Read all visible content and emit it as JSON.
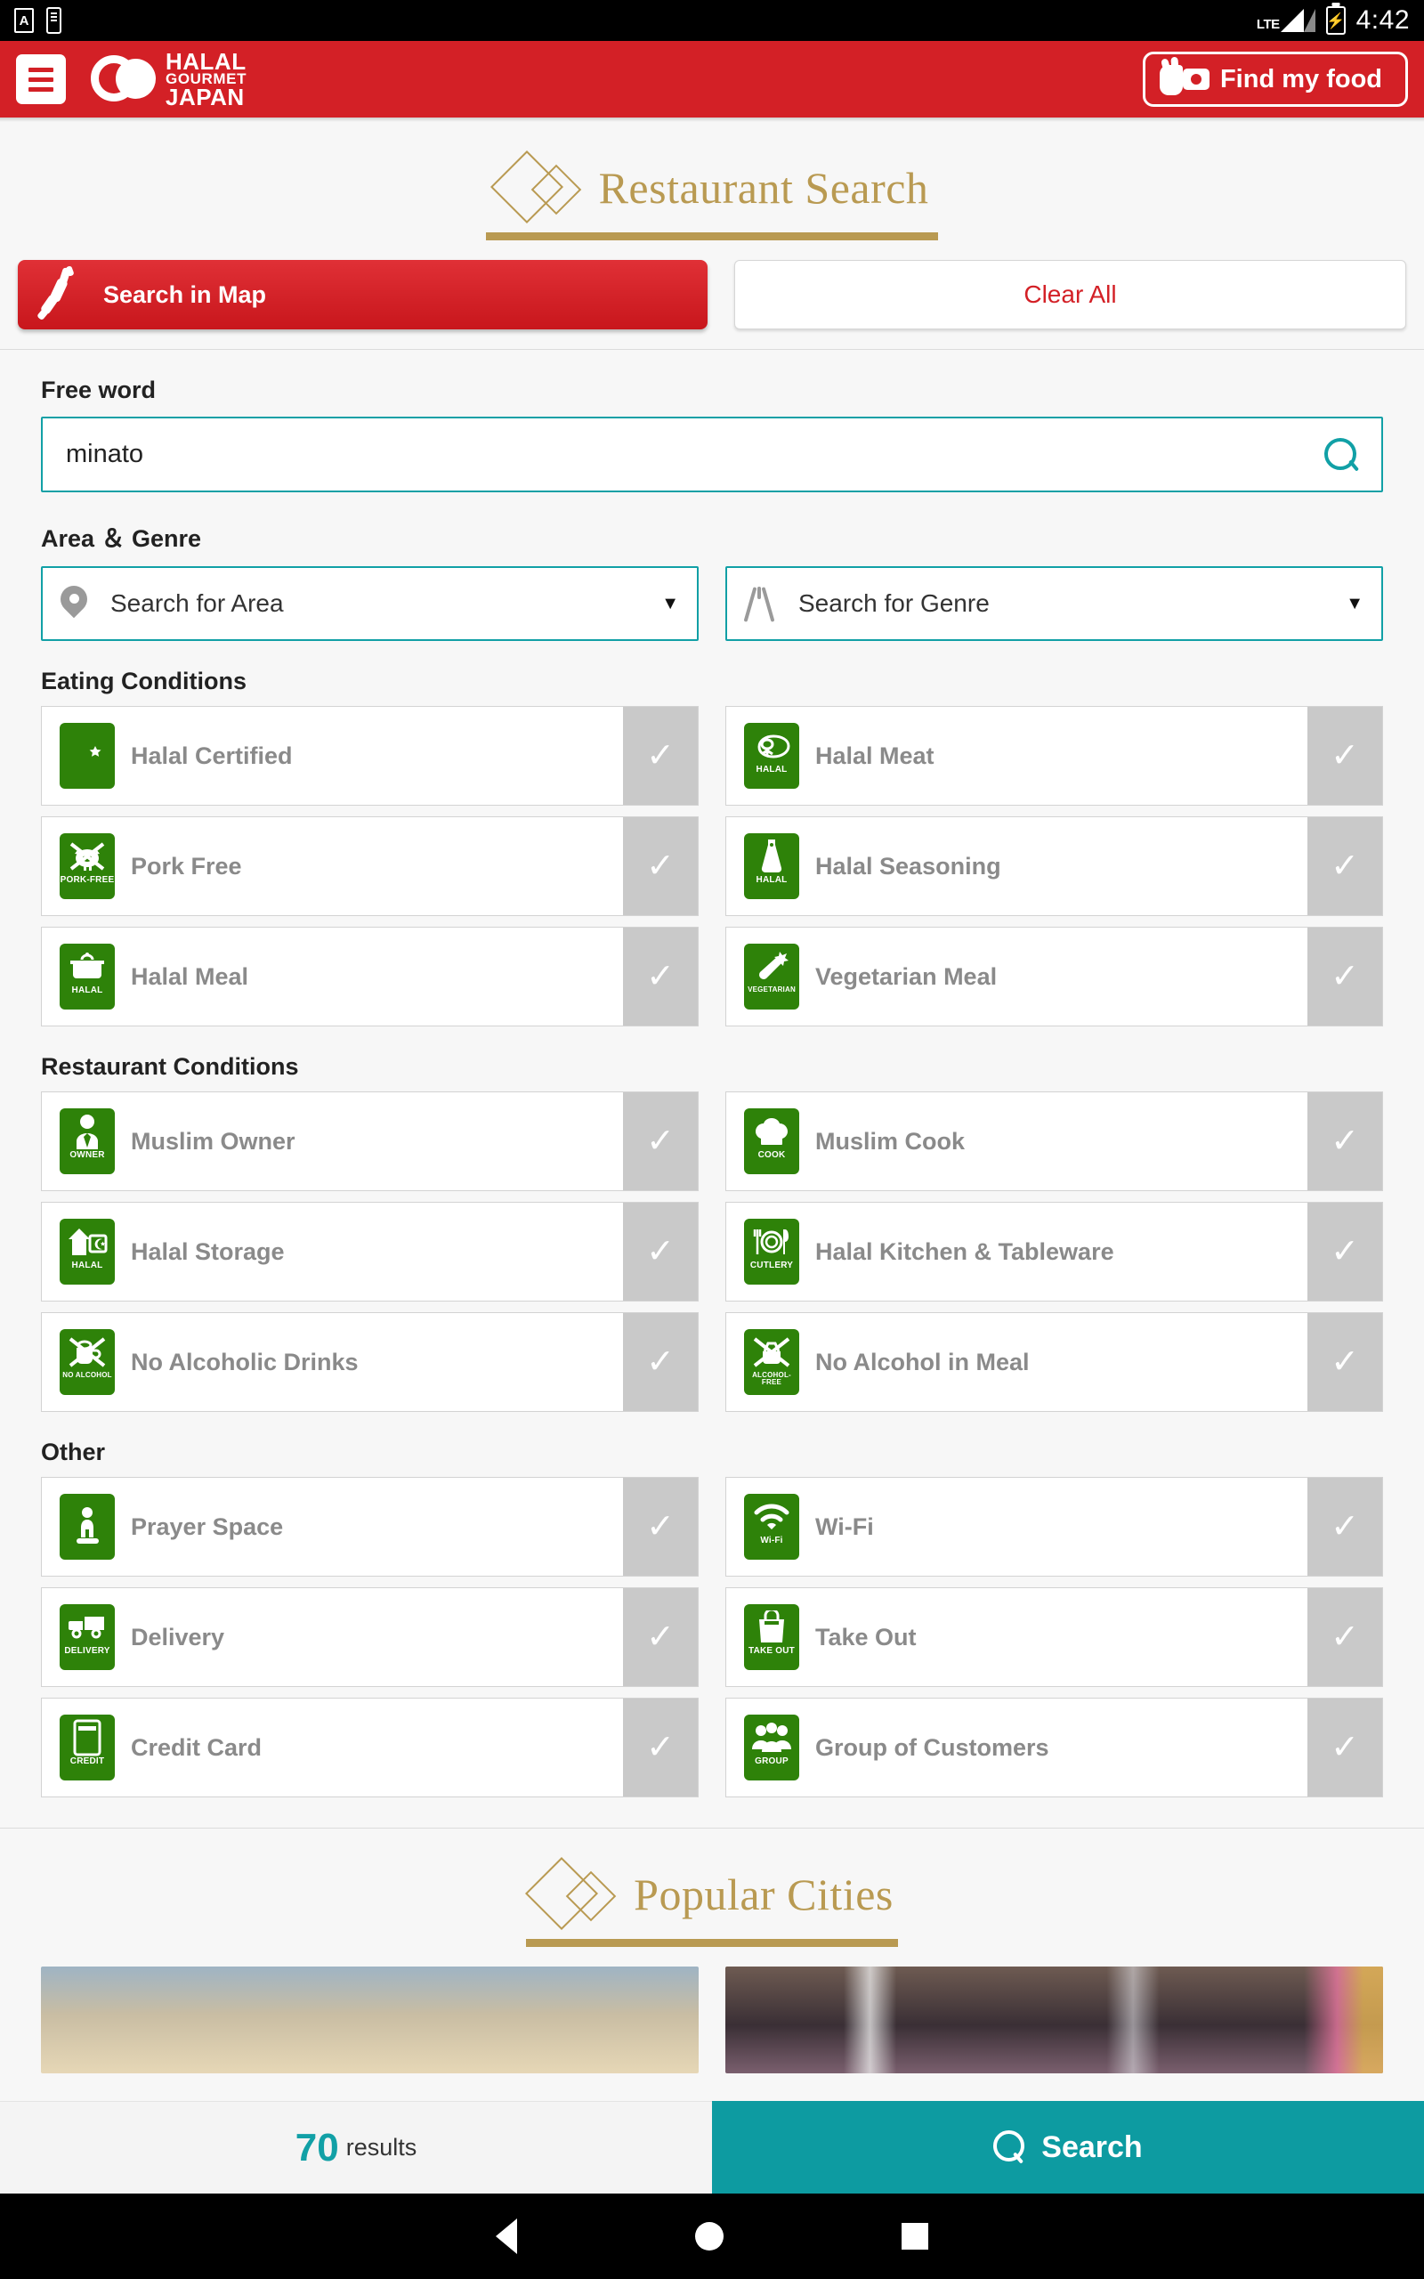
{
  "statusbar": {
    "clock": "4:42",
    "network": "LTE",
    "icon_a": "A"
  },
  "header": {
    "menu_icon": "hamburger-icon",
    "logo_line1": "HALAL",
    "logo_line2": "GOURMET",
    "logo_line3": "JAPAN",
    "find_my_food": "Find my food",
    "brand_red": "#d32026"
  },
  "page": {
    "title": "Restaurant Search",
    "accent_gold": "#b99a52",
    "accent_teal": "#11a0a6"
  },
  "top_actions": {
    "search_in_map": "Search in Map",
    "clear_all": "Clear All"
  },
  "free_word": {
    "label": "Free word",
    "value": "minato",
    "placeholder": "",
    "search_icon": "magnifier-icon"
  },
  "area_genre": {
    "label": "Area ＆ Genre",
    "area": {
      "text": "Search for Area",
      "icon": "map-pin-icon",
      "caret": "▼"
    },
    "genre": {
      "text": "Search for Genre",
      "icon": "cutlery-icon",
      "caret": "▼"
    }
  },
  "sections": [
    {
      "title": "Eating Conditions",
      "items": [
        {
          "label": "Halal Certified",
          "icon": "crescent-star-icon",
          "caption": "",
          "checked": false
        },
        {
          "label": "Halal Meat",
          "icon": "meat-icon",
          "caption": "HALAL",
          "checked": false
        },
        {
          "label": "Pork Free",
          "icon": "pig-crossed-icon",
          "caption": "PORK-FREE",
          "checked": false
        },
        {
          "label": "Halal Seasoning",
          "icon": "sauce-bottle-icon",
          "caption": "HALAL",
          "checked": false
        },
        {
          "label": "Halal Meal",
          "icon": "pot-icon",
          "caption": "HALAL",
          "checked": false
        },
        {
          "label": "Vegetarian Meal",
          "icon": "carrot-icon",
          "caption": "VEGETARIAN",
          "checked": false
        }
      ]
    },
    {
      "title": "Restaurant Conditions",
      "items": [
        {
          "label": "Muslim Owner",
          "icon": "person-suit-icon",
          "caption": "OWNER",
          "checked": false
        },
        {
          "label": "Muslim Cook",
          "icon": "chef-hat-icon",
          "caption": "COOK",
          "checked": false
        },
        {
          "label": "Halal Storage",
          "icon": "house-crescent-icon",
          "caption": "HALAL",
          "checked": false
        },
        {
          "label": "Halal Kitchen & Tableware",
          "icon": "plate-cutlery-icon",
          "caption": "CUTLERY",
          "checked": false
        },
        {
          "label": "No Alcoholic Drinks",
          "icon": "mug-crossed-icon",
          "caption": "NO ALCOHOL",
          "checked": false
        },
        {
          "label": "No Alcohol in Meal",
          "icon": "alcohol-free-icon",
          "caption": "ALCOHOL-FREE",
          "checked": false
        }
      ]
    },
    {
      "title": "Other",
      "items": [
        {
          "label": "Prayer Space",
          "icon": "praying-person-icon",
          "caption": "",
          "checked": false
        },
        {
          "label": "Wi-Fi",
          "icon": "wifi-icon",
          "caption": "Wi-Fi",
          "checked": false
        },
        {
          "label": "Delivery",
          "icon": "truck-icon",
          "caption": "DELIVERY",
          "checked": false
        },
        {
          "label": "Take Out",
          "icon": "takeout-bag-icon",
          "caption": "TAKE OUT",
          "checked": false
        },
        {
          "label": "Credit Card",
          "icon": "credit-card-icon",
          "caption": "CREDIT",
          "checked": false
        },
        {
          "label": "Group of Customers",
          "icon": "group-people-icon",
          "caption": "GROUP",
          "checked": false
        }
      ]
    }
  ],
  "popular_cities": {
    "title": "Popular Cities"
  },
  "bottom": {
    "results_count": "70",
    "results_unit": "results",
    "search_label": "Search",
    "search_icon": "magnifier-icon"
  },
  "navbar": {
    "back": "back-icon",
    "home": "home-icon",
    "recent": "recents-icon"
  }
}
